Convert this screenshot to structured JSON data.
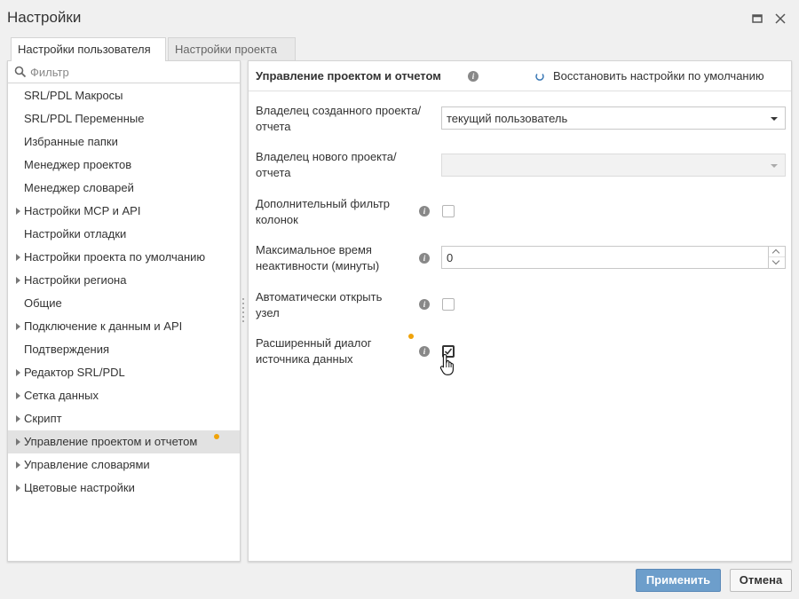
{
  "window": {
    "title": "Настройки"
  },
  "tabs": [
    {
      "label": "Настройки пользователя",
      "active": true
    },
    {
      "label": "Настройки проекта",
      "active": false
    }
  ],
  "filter": {
    "placeholder": "Фильтр"
  },
  "tree": {
    "items": [
      {
        "label": "SRL/PDL Макросы",
        "expandable": false
      },
      {
        "label": "SRL/PDL Переменные",
        "expandable": false
      },
      {
        "label": "Избранные папки",
        "expandable": false
      },
      {
        "label": "Менеджер проектов",
        "expandable": false
      },
      {
        "label": "Менеджер словарей",
        "expandable": false
      },
      {
        "label": "Настройки MCP и API",
        "expandable": true
      },
      {
        "label": "Настройки отладки",
        "expandable": false
      },
      {
        "label": "Настройки проекта по умолчанию",
        "expandable": true
      },
      {
        "label": "Настройки региона",
        "expandable": true
      },
      {
        "label": "Общие",
        "expandable": false
      },
      {
        "label": "Подключение к данным и API",
        "expandable": true
      },
      {
        "label": "Подтверждения",
        "expandable": false
      },
      {
        "label": "Редактор SRL/PDL",
        "expandable": true
      },
      {
        "label": "Сетка данных",
        "expandable": true
      },
      {
        "label": "Скрипт",
        "expandable": true
      },
      {
        "label": "Управление проектом и отчетом",
        "expandable": true,
        "selected": true,
        "modified": true
      },
      {
        "label": "Управление словарями",
        "expandable": true
      },
      {
        "label": "Цветовые настройки",
        "expandable": true
      }
    ]
  },
  "section": {
    "title": "Управление проектом и отчетом",
    "reset_label": "Восстановить настройки по умолчанию"
  },
  "fields": {
    "owner_created": {
      "label_line1": "Владелец созданного проекта/",
      "label_line2": "отчета",
      "value": "текущий пользователь"
    },
    "owner_new": {
      "label_line1": "Владелец нового проекта/",
      "label_line2": "отчета",
      "value": ""
    },
    "extra_filter": {
      "label_line1": "Дополнительный фильтр",
      "label_line2": "колонок",
      "checked": false
    },
    "max_idle": {
      "label_line1": "Максимальное время",
      "label_line2": "неактивности (минуты)",
      "value": "0"
    },
    "auto_open": {
      "label_line1": "Автоматически открыть",
      "label_line2": "узел",
      "checked": false
    },
    "extended_dialog": {
      "label_line1": "Расширенный диалог",
      "label_line2": "источника данных",
      "checked": true,
      "modified": true
    }
  },
  "buttons": {
    "apply": "Применить",
    "cancel": "Отмена"
  },
  "colors": {
    "accent": "#6d9ecb",
    "modified_dot": "#f0a30a",
    "selected_row": "#e2e2e2"
  }
}
